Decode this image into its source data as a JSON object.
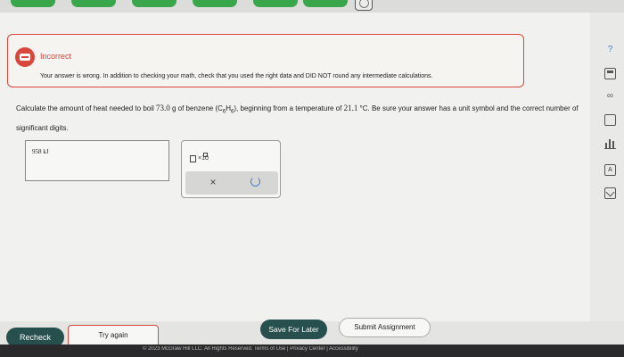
{
  "feedback": {
    "title": "Incorrect",
    "message": "Your answer is wrong. In addition to checking your math, check that you used the right data and DID NOT round any intermediate calculations."
  },
  "question": {
    "part1": "Calculate the amount of heat needed to boil ",
    "mass": "73.0",
    "part2": " g of benzene (C",
    "sub1": "6",
    "part3": "H",
    "sub2": "6",
    "part4": "), beginning from a temperature of ",
    "temp": "21.1",
    "part5": " °C. Be sure your answer has a unit symbol and the correct number of significant digits."
  },
  "answer": {
    "value": "958 kJ"
  },
  "palette": {
    "sci_label": "×10",
    "clear": "×",
    "undo": "↺"
  },
  "sidebar": {
    "help": "?",
    "link": "∞",
    "text": "A"
  },
  "buttons": {
    "recheck": "Recheck",
    "try_again": "Try again",
    "save": "Save For Later",
    "submit": "Submit Assignment"
  },
  "footer": {
    "copyright": "© 2023 McGraw Hill LLC. All Rights Reserved.  Terms of Use  |  Privacy Center  |  Accessibility"
  },
  "colors": {
    "accent": "#274f4e",
    "error": "#d9463b",
    "progress": "#3aa64b"
  }
}
